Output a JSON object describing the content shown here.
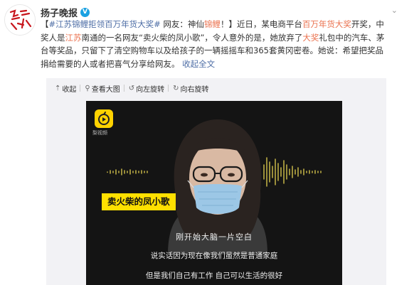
{
  "account": {
    "name": "扬子晚报",
    "verified_mark": "V",
    "avatar_text": "揚子晚報"
  },
  "header": {
    "more_icon": "chevron-down-icon"
  },
  "post": {
    "topic": "#江苏锦鲤拒领百万年货大奖#",
    "seg1": " 网友：神仙",
    "seg2": "锦鲤",
    "seg3": "！】近日，某电商平台",
    "seg4": "百万年货大奖",
    "seg5": "开奖，中奖人是",
    "seg6": "江苏",
    "seg7": "南通的一名网友“卖火柴的凤小歌”，令人意外的是，她放弃了",
    "seg8": "大奖",
    "seg9": "礼包中的汽车、茅台等奖品，只留下了清空购物车以及给孩子的一辆摇摇车和365套黄冈密卷。她说：希望把奖品捐给需要的人或者把喜气分享给网友。",
    "collapse_label": "收起全文",
    "open_bracket": "【"
  },
  "toolbar": {
    "collapse_label": "收起",
    "view_large_label": "查看大图",
    "rotate_left_label": "向左旋转",
    "rotate_right_label": "向右旋转"
  },
  "video": {
    "logo_label": "梨视频",
    "name_tag": "卖火柴的凤小歌",
    "subtitle_1": "刚开始大脑一片空白",
    "subtitle_2": "说实话因为现在像我们虽然是普通家庭",
    "subtitle_3": "但是我们自己有工作 自己可以生活的很好"
  },
  "colors": {
    "highlight": "#eb7350",
    "link": "#4e6ea6",
    "name_tag_bg": "#ffe000",
    "logo_bg": "#ffd200",
    "verified": "#1aa1e1"
  }
}
